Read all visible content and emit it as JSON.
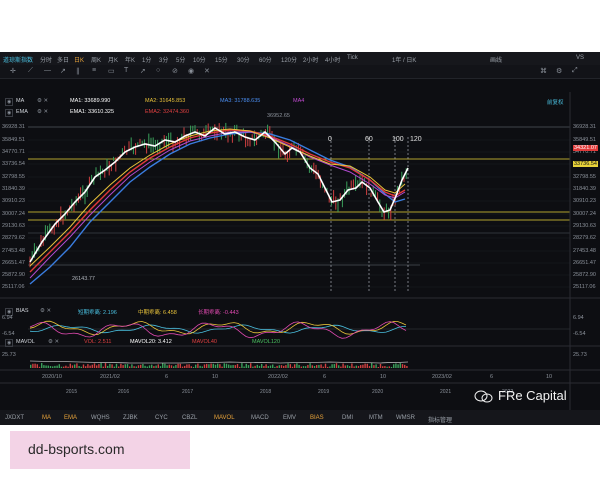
{
  "toolbar": {
    "app_label": "道琼斯指数",
    "periods": [
      "分时",
      "多日",
      "日K",
      "周K",
      "月K",
      "年K",
      "1分",
      "3分",
      "5分",
      "10分",
      "15分",
      "30分",
      "60分",
      "120分",
      "2小时",
      "4小时",
      "Tick"
    ],
    "active_period": "日K",
    "dropdown": "1年 / 日K",
    "right_items": [
      "画线",
      "VS"
    ]
  },
  "legend": {
    "ma_label": "MA",
    "ma_values": [
      {
        "text": "MA1: 33689.990",
        "color": "#ffffff"
      },
      {
        "text": "MA2: 31645.853",
        "color": "#e8c23a"
      },
      {
        "text": "MA3: 31788.635",
        "color": "#4a8df0"
      },
      {
        "text": "MA4",
        "color": "#c04ad0"
      }
    ],
    "ema_label": "EMA",
    "ema_values": [
      {
        "text": "EMA1: 33610.325",
        "color": "#ffffff"
      },
      {
        "text": "EMA2: 32474.360",
        "color": "#e04040"
      }
    ],
    "peak_label": "36952.65",
    "hold_button": "前复权"
  },
  "price_axis_left": [
    "36928.31",
    "35849.51",
    "34770.71",
    "33736.54",
    "32798.55",
    "31840.39",
    "30910.23",
    "30007.24",
    "29130.63",
    "28279.62",
    "27453.48",
    "26651.47",
    "25872.90",
    "25117.06"
  ],
  "price_axis_right": [
    "36928.31",
    "35849.51",
    "34770.71",
    "33736.54",
    "32798.55",
    "31840.39",
    "30910.23",
    "30007.24",
    "29130.63",
    "28279.62",
    "27453.48",
    "26651.47",
    "25872.90",
    "25117.06"
  ],
  "price_axis_highlight": "33736.54",
  "current_price": "34321.07",
  "low_label": "26143.77",
  "cycle_labels": [
    "0",
    "60",
    "100",
    "120"
  ],
  "bias": {
    "label": "BIAS",
    "values": [
      {
        "text": "短期乖离: 2.196",
        "color": "#4ac0e0"
      },
      {
        "text": "中期乖离: 6.458",
        "color": "#e8c23a"
      },
      {
        "text": "长期乖离: -0.443",
        "color": "#e04ab0"
      }
    ],
    "axis_top": "6.94",
    "axis_bottom": "-6.54"
  },
  "mavol": {
    "label": "MAVOL",
    "values": [
      {
        "text": "VOL: 2.511",
        "color": "#e04040"
      },
      {
        "text": "MAVOL20: 3.412",
        "color": "#ffffff"
      },
      {
        "text": "MAVOL40",
        "color": "#e04040"
      },
      {
        "text": "MAVOL120",
        "color": "#4ac060"
      }
    ],
    "axis_top": "25.73"
  },
  "x_axis": {
    "upper": [
      "2020/10",
      "2021/02",
      "6",
      "10",
      "2022/02",
      "6",
      "10",
      "2023/02",
      "6",
      "10"
    ],
    "lower": [
      "2015",
      "2016",
      "2017",
      "2018",
      "2019",
      "2020",
      "2021",
      "2022"
    ]
  },
  "indicators": [
    "JXDXT",
    "MA",
    "EMA",
    "WQHS",
    "ZJBK",
    "CYC",
    "CBZL",
    "MAVOL",
    "MACD",
    "EMV",
    "BIAS",
    "DMI",
    "MTM",
    "WMSR",
    "指标管理"
  ],
  "active_indicators": [
    "MA",
    "EMA",
    "MAVOL",
    "BIAS"
  ],
  "watermark_text": "FRe Capital",
  "url_label": "dd-bsports.com"
}
